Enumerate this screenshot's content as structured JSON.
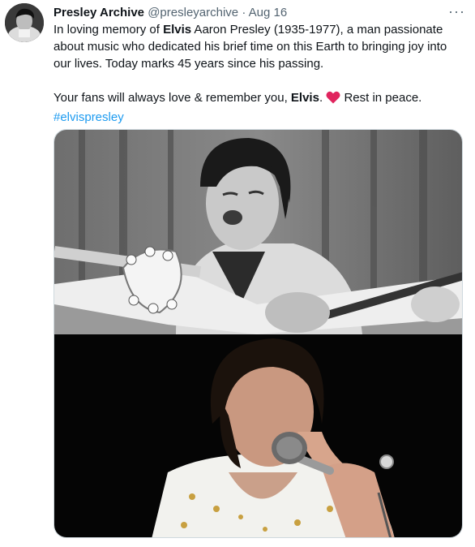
{
  "tweet": {
    "author_name": "Presley Archive",
    "handle": "@presleyarchive",
    "separator": "·",
    "date": "Aug 16",
    "more_label": "···",
    "text": {
      "l1_a": "In loving memory of ",
      "l1_bold": "Elvis",
      "l1_b": " Aaron Presley (1935-1977), a man passionate about music who dedicated his brief time on this Earth to bringing joy into our lives. Today marks 45 years since his passing.",
      "l2_a": "Your fans will always love & remember you, ",
      "l2_bold": "Elvis",
      "l2_b": ". ",
      "l2_c": " Rest in peace.",
      "hashtag": "#elvispresley"
    },
    "icons": {
      "heart": "red-heart-emoji",
      "more": "more-options-icon"
    },
    "colors": {
      "link": "#1d9bf0",
      "secondary_text": "#536471",
      "heart": "#e0245e"
    },
    "media": [
      {
        "description_id": "photo-1",
        "style": "black-and-white"
      },
      {
        "description_id": "photo-2",
        "style": "color"
      }
    ]
  }
}
